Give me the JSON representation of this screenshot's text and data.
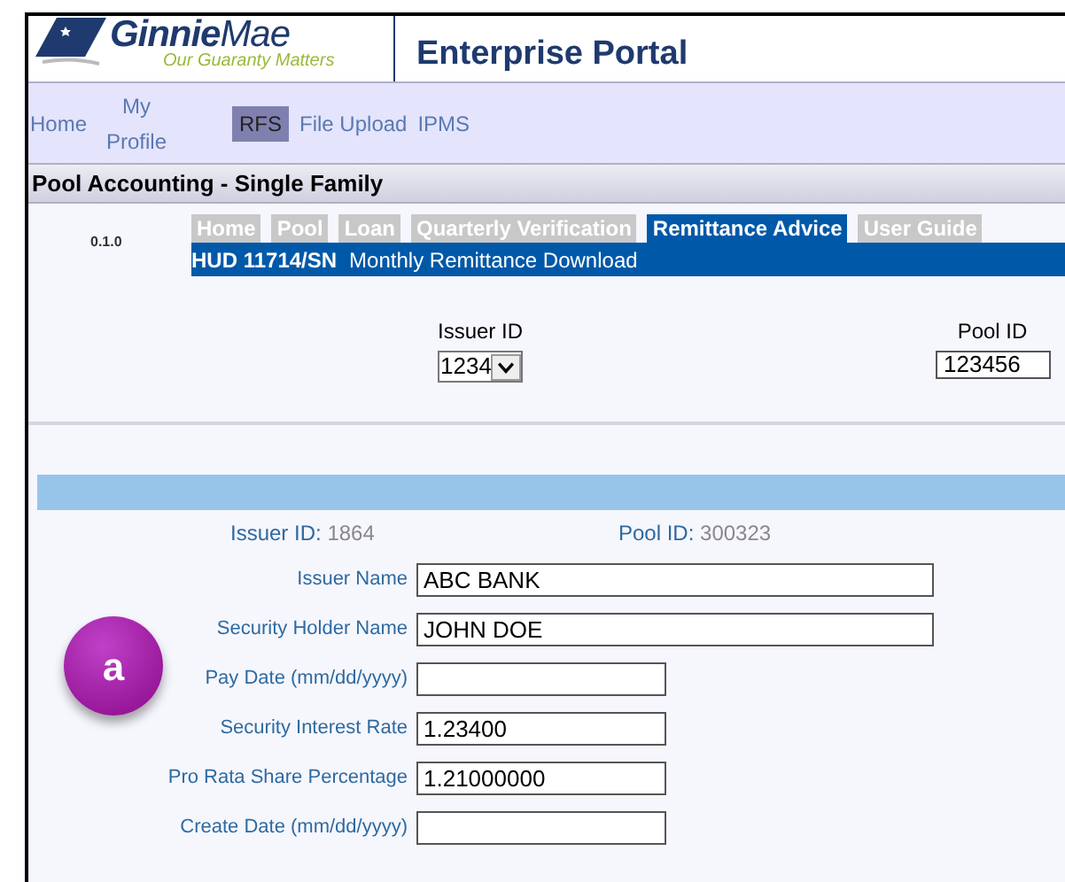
{
  "logo": {
    "name_bold": "Ginnie",
    "name_light": "Mae",
    "tagline": "Our Guaranty Matters"
  },
  "portal_title": "Enterprise Portal",
  "nav": [
    {
      "label": "Home",
      "selected": false
    },
    {
      "label": "My Profile",
      "selected": false
    },
    {
      "label": "RFS",
      "selected": true
    },
    {
      "label": "File Upload",
      "selected": false
    },
    {
      "label": "IPMS",
      "selected": false
    }
  ],
  "section_title": "Pool Accounting - Single Family",
  "version": "0.1.0",
  "tabs": [
    {
      "label": "Home",
      "selected": false
    },
    {
      "label": "Pool",
      "selected": false
    },
    {
      "label": "Loan",
      "selected": false
    },
    {
      "label": "Quarterly Verification",
      "selected": false
    },
    {
      "label": "Remittance Advice",
      "selected": true
    },
    {
      "label": "User Guide",
      "selected": false
    }
  ],
  "subheader": {
    "code": "HUD 11714/SN",
    "title": "Monthly Remittance Download"
  },
  "issuer_select": {
    "label": "Issuer ID",
    "value": "1234"
  },
  "pool_field": {
    "label": "Pool ID",
    "value": "123456"
  },
  "summary": [
    {
      "label": "Issuer ID:",
      "value": "1864"
    },
    {
      "label": "Pool ID:",
      "value": "300323"
    }
  ],
  "form_fields": [
    {
      "label": "Issuer Name",
      "value": "ABC BANK",
      "kind": "wide"
    },
    {
      "label": "Security Holder Name",
      "value": "JOHN DOE",
      "kind": "wide"
    },
    {
      "label": "Pay Date (mm/dd/yyyy)",
      "kind": "narrow"
    },
    {
      "label": "Security Interest Rate",
      "value": "1.23400",
      "kind": "narrow"
    },
    {
      "label": "Pro Rata Share Percentage",
      "value": "1.21000000",
      "kind": "narrow"
    },
    {
      "label": "Create Date (mm/dd/yyyy)",
      "kind": "narrow"
    }
  ],
  "annotation": "a"
}
